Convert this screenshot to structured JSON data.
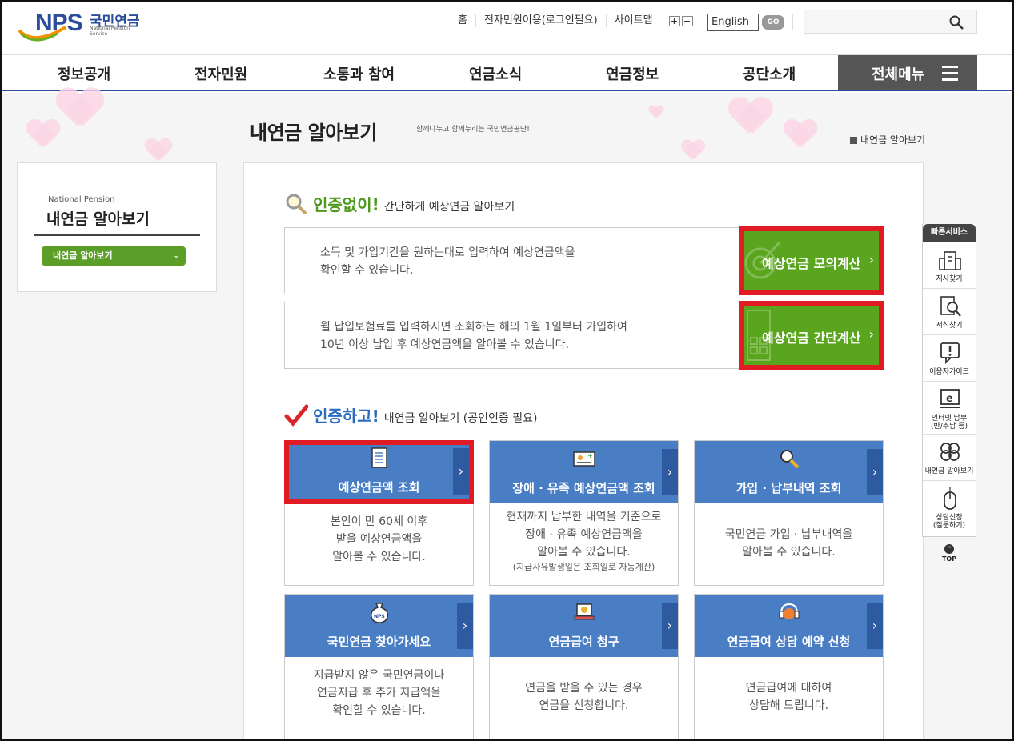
{
  "header": {
    "logo_text": "NPS",
    "logo_kr": "국민연금",
    "logo_en": "National Pension Service",
    "util_links": [
      "홈",
      "전자민원이용(로그인필요)",
      "사이트맵"
    ],
    "zoom_in": "+",
    "zoom_out": "−",
    "language": "English",
    "go_label": "GO",
    "search_placeholder": ""
  },
  "gnb": {
    "items": [
      "정보공개",
      "전자민원",
      "소통과 참여",
      "연금소식",
      "연금정보",
      "공단소개"
    ],
    "all_menu": "전체메뉴"
  },
  "page": {
    "title": "내연금 알아보기",
    "subtitle": "함께나누고 함께누리는 국민연금공단!",
    "breadcrumb": "내연금 알아보기"
  },
  "lnb": {
    "en": "National Pension",
    "title": "내연금 알아보기",
    "selected": "내연금 알아보기"
  },
  "section1": {
    "strong": "인증없이!",
    "rest": "간단하게 예상연금 알아보기",
    "strong_color": "#4e9a1e",
    "boxes": [
      {
        "line1": "소득 및 가입기간을 원하는대로 입력하여 예상연금액을",
        "line2": "확인할 수 있습니다.",
        "button": "예상연금 모의계산"
      },
      {
        "line1": "월 납입보험료를 입력하시면 조회하는 해의 1월 1일부터 가입하여",
        "line2": "10년 이상 납입 후 예상연금액을 알아볼 수 있습니다.",
        "button": "예상연금 간단계산"
      }
    ]
  },
  "section2": {
    "strong": "인증하고!",
    "rest": "내연금 알아보기 (공인인증 필요)",
    "strong_color": "#2c6cc0",
    "cards": [
      {
        "title": "예상연금액 조회",
        "icon": "document-icon",
        "lines": [
          "본인이 만 60세 이후",
          "받을 예상연금액을",
          "알아볼 수 있습니다."
        ],
        "note": ""
      },
      {
        "title": "장애 · 유족 예상연금액 조회",
        "icon": "id-card-icon",
        "lines": [
          "현재까지 납부한 내역을 기준으로",
          "장애  · 유족 예상연금액을",
          "알아볼 수 있습니다."
        ],
        "note": "(지급사유발생일은 조회일로 자동계산)"
      },
      {
        "title": "가입 · 납부내역 조회",
        "icon": "magnifier-icon",
        "lines": [
          "국민연금 가입  · 납부내역을",
          "알아볼 수 있습니다."
        ],
        "note": ""
      },
      {
        "title": "국민연금 찾아가세요",
        "icon": "money-bag-icon",
        "lines": [
          "지급받지 않은 국민연금이나",
          "연금지급 후 추가 지급액을",
          "확인할 수 있습니다."
        ],
        "note": ""
      },
      {
        "title": "연금급여 청구",
        "icon": "laptop-icon",
        "lines": [
          "연금을 받을 수 있는 경우",
          "연금을 신청합니다."
        ],
        "note": ""
      },
      {
        "title": "연금급여 상담 예약 신청",
        "icon": "headset-icon",
        "lines": [
          "연금급여에 대하여",
          "상담해 드립니다."
        ],
        "note": ""
      }
    ]
  },
  "quick": {
    "title": "빠른서비스",
    "items": [
      {
        "label": "지사찾기",
        "icon": "building-icon"
      },
      {
        "label": "서식찾기",
        "icon": "form-search-icon"
      },
      {
        "label": "이용자가이드",
        "icon": "guide-icon"
      },
      {
        "label": "인터넷 납부\n(반/추납 등)",
        "icon": "internet-payment-icon"
      },
      {
        "label": "내연금 알아보기",
        "icon": "clover-icon"
      },
      {
        "label": "상담신청\n(질문하기)",
        "icon": "mouse-icon"
      }
    ],
    "top": "TOP"
  },
  "colors": {
    "brand": "#2c4c9c",
    "green": "#5aa51e",
    "card_blue": "#4a7ec4",
    "highlight": "#e01b24"
  }
}
